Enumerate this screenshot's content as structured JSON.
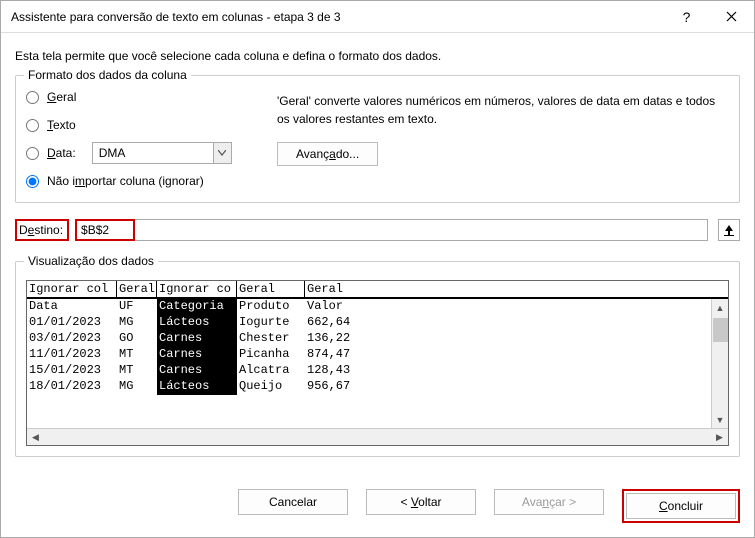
{
  "titlebar": {
    "title": "Assistente para conversão de texto em colunas - etapa 3 de 3"
  },
  "instruction": "Esta tela permite que você selecione cada coluna e defina o formato dos dados.",
  "format": {
    "legend": "Formato dos dados da coluna",
    "radio_general_pre": "",
    "radio_general_u": "G",
    "radio_general_post": "eral",
    "radio_text_pre": "",
    "radio_text_u": "T",
    "radio_text_post": "exto",
    "radio_date_pre": "",
    "radio_date_u": "D",
    "radio_date_post": "ata:",
    "radio_skip_pre": "Não i",
    "radio_skip_u": "m",
    "radio_skip_post": "portar coluna (ignorar)",
    "date_combo": "DMA",
    "desc": "'Geral' converte valores numéricos em números, valores de data em datas e todos os valores restantes em texto.",
    "advanced_pre": "Avanç",
    "advanced_u": "a",
    "advanced_post": "do..."
  },
  "destination": {
    "label_pre": "D",
    "label_u": "e",
    "label_post": "stino:",
    "value": "$B$2"
  },
  "preview": {
    "legend": "Visualização dos dados",
    "headers": [
      "Ignorar col",
      "Geral",
      "Ignorar co",
      "Geral",
      "Geral"
    ],
    "rows": [
      [
        "Data",
        "UF",
        "Categoria",
        "Produto",
        "Valor"
      ],
      [
        "01/01/2023",
        "MG",
        "Lácteos",
        "Iogurte",
        "662,64"
      ],
      [
        "03/01/2023",
        "GO",
        "Carnes",
        "Chester",
        "136,22"
      ],
      [
        "11/01/2023",
        "MT",
        "Carnes",
        "Picanha",
        "874,47"
      ],
      [
        "15/01/2023",
        "MT",
        "Carnes",
        "Alcatra",
        "128,43"
      ],
      [
        "18/01/2023",
        "MG",
        "Lácteos",
        "Queijo",
        "956,67"
      ]
    ]
  },
  "footer": {
    "cancel": "Cancelar",
    "back_pre": "< ",
    "back_u": "V",
    "back_post": "oltar",
    "next_pre": "Ava",
    "next_u": "n",
    "next_post": "çar >",
    "finish_pre": "",
    "finish_u": "C",
    "finish_post": "oncluir"
  }
}
